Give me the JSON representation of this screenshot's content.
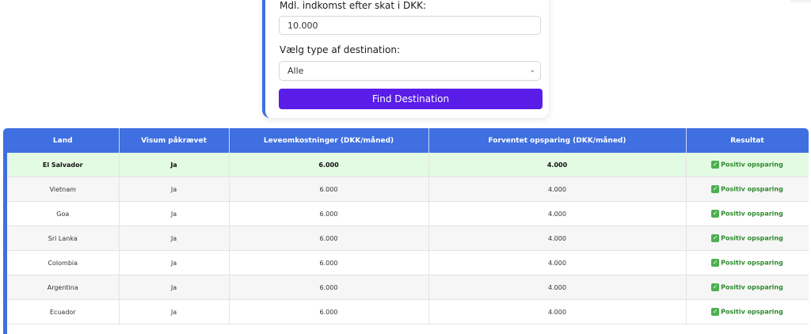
{
  "form": {
    "income_label": "Mdl. indkomst efter skat i DKK:",
    "income_value": "10.000",
    "destination_label": "Vælg type af destination:",
    "destination_selected": "Alle",
    "find_button": "Find Destination"
  },
  "table": {
    "headers": [
      "Land",
      "Visum påkrævet",
      "Leveomkostninger (DKK/måned)",
      "Forventet opsparing (DKK/måned)",
      "Resultat"
    ],
    "rows": [
      {
        "land": "El Salvador",
        "visum": "Ja",
        "cost": "6.000",
        "saving": "4.000",
        "result": "Positiv opsparing"
      },
      {
        "land": "Vietnam",
        "visum": "Ja",
        "cost": "6.000",
        "saving": "4.000",
        "result": "Positiv opsparing"
      },
      {
        "land": "Goa",
        "visum": "Ja",
        "cost": "6.000",
        "saving": "4.000",
        "result": "Positiv opsparing"
      },
      {
        "land": "Sri Lanka",
        "visum": "Ja",
        "cost": "6.000",
        "saving": "4.000",
        "result": "Positiv opsparing"
      },
      {
        "land": "Colombia",
        "visum": "Ja",
        "cost": "6.000",
        "saving": "4.000",
        "result": "Positiv opsparing"
      },
      {
        "land": "Argentina",
        "visum": "Ja",
        "cost": "6.000",
        "saving": "4.000",
        "result": "Positiv opsparing"
      },
      {
        "land": "Ecuador",
        "visum": "Ja",
        "cost": "6.000",
        "saving": "4.000",
        "result": "Positiv opsparing"
      }
    ]
  },
  "colors": {
    "accent": "#3f6fe0",
    "button": "#5a1de8",
    "highlight_row": "#e3fbe3",
    "positive": "#2d8a2d"
  }
}
